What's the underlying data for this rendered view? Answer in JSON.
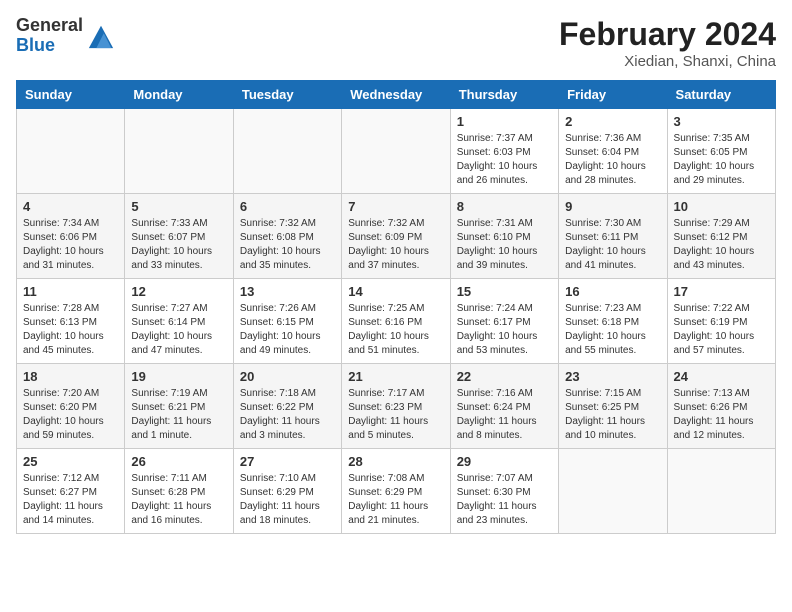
{
  "header": {
    "logo_general": "General",
    "logo_blue": "Blue",
    "title": "February 2024",
    "subtitle": "Xiedian, Shanxi, China"
  },
  "days_of_week": [
    "Sunday",
    "Monday",
    "Tuesday",
    "Wednesday",
    "Thursday",
    "Friday",
    "Saturday"
  ],
  "weeks": [
    [
      {
        "day": null,
        "info": null
      },
      {
        "day": null,
        "info": null
      },
      {
        "day": null,
        "info": null
      },
      {
        "day": null,
        "info": null
      },
      {
        "day": "1",
        "info": "Sunrise: 7:37 AM\nSunset: 6:03 PM\nDaylight: 10 hours and 26 minutes."
      },
      {
        "day": "2",
        "info": "Sunrise: 7:36 AM\nSunset: 6:04 PM\nDaylight: 10 hours and 28 minutes."
      },
      {
        "day": "3",
        "info": "Sunrise: 7:35 AM\nSunset: 6:05 PM\nDaylight: 10 hours and 29 minutes."
      }
    ],
    [
      {
        "day": "4",
        "info": "Sunrise: 7:34 AM\nSunset: 6:06 PM\nDaylight: 10 hours and 31 minutes."
      },
      {
        "day": "5",
        "info": "Sunrise: 7:33 AM\nSunset: 6:07 PM\nDaylight: 10 hours and 33 minutes."
      },
      {
        "day": "6",
        "info": "Sunrise: 7:32 AM\nSunset: 6:08 PM\nDaylight: 10 hours and 35 minutes."
      },
      {
        "day": "7",
        "info": "Sunrise: 7:32 AM\nSunset: 6:09 PM\nDaylight: 10 hours and 37 minutes."
      },
      {
        "day": "8",
        "info": "Sunrise: 7:31 AM\nSunset: 6:10 PM\nDaylight: 10 hours and 39 minutes."
      },
      {
        "day": "9",
        "info": "Sunrise: 7:30 AM\nSunset: 6:11 PM\nDaylight: 10 hours and 41 minutes."
      },
      {
        "day": "10",
        "info": "Sunrise: 7:29 AM\nSunset: 6:12 PM\nDaylight: 10 hours and 43 minutes."
      }
    ],
    [
      {
        "day": "11",
        "info": "Sunrise: 7:28 AM\nSunset: 6:13 PM\nDaylight: 10 hours and 45 minutes."
      },
      {
        "day": "12",
        "info": "Sunrise: 7:27 AM\nSunset: 6:14 PM\nDaylight: 10 hours and 47 minutes."
      },
      {
        "day": "13",
        "info": "Sunrise: 7:26 AM\nSunset: 6:15 PM\nDaylight: 10 hours and 49 minutes."
      },
      {
        "day": "14",
        "info": "Sunrise: 7:25 AM\nSunset: 6:16 PM\nDaylight: 10 hours and 51 minutes."
      },
      {
        "day": "15",
        "info": "Sunrise: 7:24 AM\nSunset: 6:17 PM\nDaylight: 10 hours and 53 minutes."
      },
      {
        "day": "16",
        "info": "Sunrise: 7:23 AM\nSunset: 6:18 PM\nDaylight: 10 hours and 55 minutes."
      },
      {
        "day": "17",
        "info": "Sunrise: 7:22 AM\nSunset: 6:19 PM\nDaylight: 10 hours and 57 minutes."
      }
    ],
    [
      {
        "day": "18",
        "info": "Sunrise: 7:20 AM\nSunset: 6:20 PM\nDaylight: 10 hours and 59 minutes."
      },
      {
        "day": "19",
        "info": "Sunrise: 7:19 AM\nSunset: 6:21 PM\nDaylight: 11 hours and 1 minute."
      },
      {
        "day": "20",
        "info": "Sunrise: 7:18 AM\nSunset: 6:22 PM\nDaylight: 11 hours and 3 minutes."
      },
      {
        "day": "21",
        "info": "Sunrise: 7:17 AM\nSunset: 6:23 PM\nDaylight: 11 hours and 5 minutes."
      },
      {
        "day": "22",
        "info": "Sunrise: 7:16 AM\nSunset: 6:24 PM\nDaylight: 11 hours and 8 minutes."
      },
      {
        "day": "23",
        "info": "Sunrise: 7:15 AM\nSunset: 6:25 PM\nDaylight: 11 hours and 10 minutes."
      },
      {
        "day": "24",
        "info": "Sunrise: 7:13 AM\nSunset: 6:26 PM\nDaylight: 11 hours and 12 minutes."
      }
    ],
    [
      {
        "day": "25",
        "info": "Sunrise: 7:12 AM\nSunset: 6:27 PM\nDaylight: 11 hours and 14 minutes."
      },
      {
        "day": "26",
        "info": "Sunrise: 7:11 AM\nSunset: 6:28 PM\nDaylight: 11 hours and 16 minutes."
      },
      {
        "day": "27",
        "info": "Sunrise: 7:10 AM\nSunset: 6:29 PM\nDaylight: 11 hours and 18 minutes."
      },
      {
        "day": "28",
        "info": "Sunrise: 7:08 AM\nSunset: 6:29 PM\nDaylight: 11 hours and 21 minutes."
      },
      {
        "day": "29",
        "info": "Sunrise: 7:07 AM\nSunset: 6:30 PM\nDaylight: 11 hours and 23 minutes."
      },
      {
        "day": null,
        "info": null
      },
      {
        "day": null,
        "info": null
      }
    ]
  ]
}
